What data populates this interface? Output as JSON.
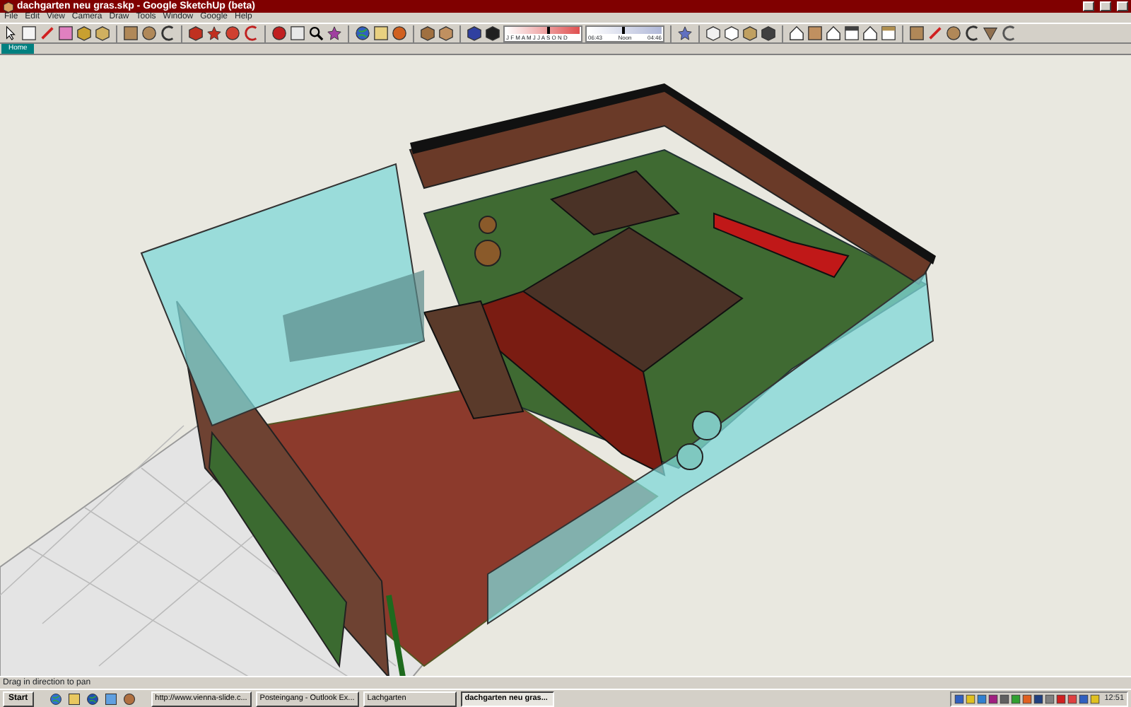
{
  "window": {
    "title": "dachgarten neu gras.skp - Google SketchUp (beta)"
  },
  "menu": [
    "File",
    "Edit",
    "View",
    "Camera",
    "Draw",
    "Tools",
    "Window",
    "Google",
    "Help"
  ],
  "shadow_settings": {
    "date_slider": {
      "months": "J F M A M J J A S O N D",
      "level": 0.6
    },
    "time_slider": {
      "start": "06:43",
      "middle": "Noon",
      "end": "04:46",
      "level": 0.5
    }
  },
  "scene_tabs": [
    {
      "label": "Home",
      "selected": true
    }
  ],
  "status_bar": "Drag in direction to pan",
  "taskbar": {
    "start": "Start",
    "tasks": [
      {
        "label": "http://www.vienna-slide.c...",
        "selected": false
      },
      {
        "label": "Posteingang - Outlook Ex...",
        "selected": false
      },
      {
        "label": "Lachgarten",
        "selected": false
      },
      {
        "label": "dachgarten neu gras...",
        "selected": true
      }
    ],
    "clock": "12:51"
  }
}
